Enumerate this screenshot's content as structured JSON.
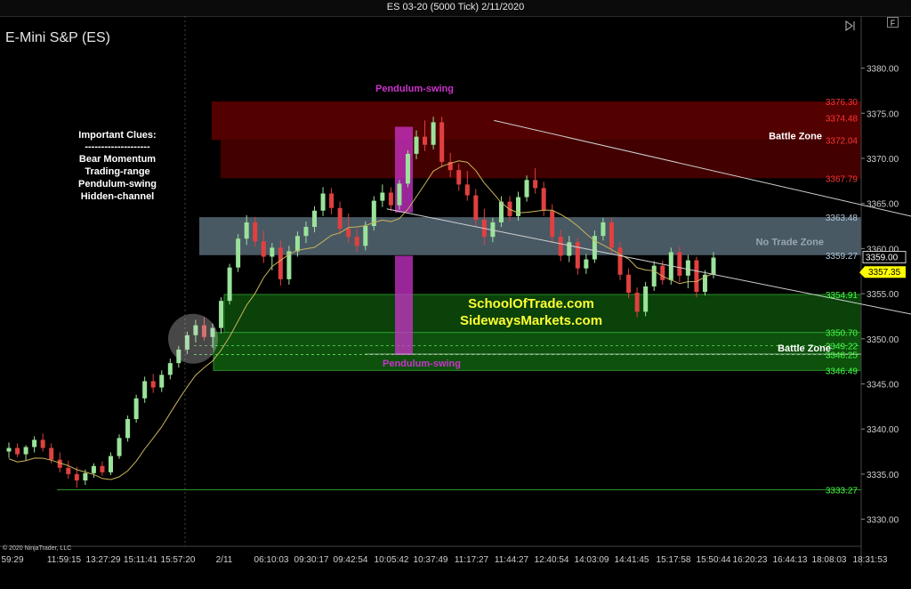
{
  "window": {
    "title": "ES 03-20 (5000 Tick)  2/11/2020"
  },
  "toolbar": {
    "f_label": "F",
    "nav_icon": "skip-end-icon"
  },
  "chart_title": "E-Mini S&P (ES)",
  "copyright": "© 2020 NinjaTrader, LLC",
  "clues": {
    "title": "Important Clues:",
    "separator": "--------------------",
    "items": [
      "Bear Momentum",
      "Trading-range",
      "Pendulum-swing",
      "Hidden-channel"
    ]
  },
  "watermark": [
    "SchoolOfTrade.com",
    "SidewaysMarkets.com"
  ],
  "chart_data": {
    "type": "candlestick",
    "ylim": [
      3327,
      3384
    ],
    "y_ticks": [
      3380,
      3375,
      3370,
      3365,
      3360,
      3355,
      3350,
      3345,
      3340,
      3335,
      3330
    ],
    "y_tick_labels": [
      "3380.00",
      "3375.00",
      "3370.00",
      "3365.00",
      "3360.00",
      "3355.00",
      "3350.00",
      "3345.00",
      "3340.00",
      "3335.00",
      "3330.00"
    ],
    "x_tick_labels": [
      "59:29",
      "11:59:15",
      "13:27:29",
      "15:11:41",
      "15:57:20",
      "2/11",
      "06:10:03",
      "09:30:17",
      "09:42:54",
      "10:05:42",
      "10:37:49",
      "11:17:27",
      "11:44:27",
      "12:40:54",
      "14:03:09",
      "14:41:45",
      "15:17:58",
      "15:50:44",
      "16:20:23",
      "16:44:13",
      "18:08:03",
      "18:31:53"
    ],
    "x_tick_count": 22,
    "last_price": {
      "value": 3359.0,
      "label": "3359.00"
    },
    "current_price": {
      "value": 3357.35,
      "label": "3357.35",
      "color": "#ffff00"
    },
    "zones": [
      {
        "name": "resistance-outer",
        "top": 3376.3,
        "bottom": 3372.04,
        "color": "#5c0000"
      },
      {
        "name": "resistance-inner",
        "top": 3372.04,
        "bottom": 3367.79,
        "color": "#4a0000"
      },
      {
        "name": "no-trade",
        "top": 3363.48,
        "bottom": 3359.27,
        "color": "#5a6f7d"
      },
      {
        "name": "support-inner",
        "top": 3354.91,
        "bottom": 3350.7,
        "color": "#0c4a0c"
      },
      {
        "name": "support-outer",
        "top": 3350.7,
        "bottom": 3346.49,
        "color": "#0f5a0f"
      }
    ],
    "level_labels": [
      {
        "value": 3376.3,
        "label": "3376.30",
        "color": "#ff3333"
      },
      {
        "value": 3374.48,
        "label": "3374.48",
        "color": "#ff3333"
      },
      {
        "value": 3372.04,
        "label": "3372.04",
        "color": "#ff3333"
      },
      {
        "value": 3367.79,
        "label": "3367.79",
        "color": "#ff3333"
      },
      {
        "value": 3363.48,
        "label": "3363.48",
        "color": "#b0c4d4"
      },
      {
        "value": 3359.27,
        "label": "3359.27",
        "color": "#b0c4d4"
      },
      {
        "value": 3354.91,
        "label": "3354.91",
        "color": "#44ff44"
      },
      {
        "value": 3350.7,
        "label": "3350.70",
        "color": "#44ff44"
      },
      {
        "value": 3349.22,
        "label": "3349.22",
        "color": "#44ff44"
      },
      {
        "value": 3348.25,
        "label": "3348.25",
        "color": "#44ff44"
      },
      {
        "value": 3346.49,
        "label": "3346.49",
        "color": "#44ff44"
      },
      {
        "value": 3333.27,
        "label": "3333.27",
        "color": "#44ff44"
      }
    ],
    "zone_labels": [
      {
        "text": "Battle Zone",
        "value": 3372.5,
        "color": "#ffffff"
      },
      {
        "text": "No Trade Zone",
        "value": 3360.8,
        "color": "#9aa6ad"
      },
      {
        "text": "Battle Zone",
        "value": 3349.0,
        "color": "#ffffff"
      }
    ],
    "pendulum_labels": [
      "Pendulum-swing",
      "Pendulum-swing"
    ],
    "pendulum_color": "#cc33cc",
    "trend_lines": [
      {
        "from": [
          95,
          3374.2
        ],
        "to": [
          192,
          3361.6
        ],
        "color": "#cfcfcf"
      },
      {
        "from": [
          74,
          3364.4
        ],
        "to": [
          192,
          3351.0
        ],
        "color": "#cfcfcf"
      }
    ],
    "candles": [
      [
        3337.5,
        3338.5,
        3336.8,
        3337.9
      ],
      [
        3337.9,
        3338.4,
        3336.9,
        3337.2
      ],
      [
        3337.2,
        3338.2,
        3336.5,
        3338.0
      ],
      [
        3338.0,
        3339.2,
        3337.4,
        3338.8
      ],
      [
        3338.8,
        3339.5,
        3337.5,
        3337.9
      ],
      [
        3337.9,
        3338.4,
        3336.2,
        3336.6
      ],
      [
        3336.6,
        3337.4,
        3335.2,
        3335.7
      ],
      [
        3335.7,
        3336.5,
        3334.5,
        3335.0
      ],
      [
        3335.0,
        3335.8,
        3333.5,
        3334.3
      ],
      [
        3334.3,
        3335.5,
        3333.8,
        3335.1
      ],
      [
        3335.1,
        3336.2,
        3334.6,
        3335.9
      ],
      [
        3335.9,
        3336.4,
        3334.8,
        3335.2
      ],
      [
        3335.2,
        3337.4,
        3334.9,
        3337.0
      ],
      [
        3337.0,
        3339.4,
        3336.7,
        3339.0
      ],
      [
        3339.0,
        3341.5,
        3338.6,
        3341.1
      ],
      [
        3341.1,
        3343.8,
        3340.7,
        3343.4
      ],
      [
        3343.4,
        3345.8,
        3342.9,
        3345.3
      ],
      [
        3345.3,
        3346.1,
        3344.0,
        3344.6
      ],
      [
        3344.6,
        3346.5,
        3344.1,
        3346.0
      ],
      [
        3346.0,
        3347.8,
        3345.5,
        3347.3
      ],
      [
        3347.3,
        3349.2,
        3346.8,
        3348.8
      ],
      [
        3348.8,
        3350.8,
        3348.3,
        3350.4
      ],
      [
        3350.4,
        3352.1,
        3349.6,
        3351.5
      ],
      [
        3351.5,
        3352.4,
        3349.8,
        3350.2
      ],
      [
        3350.2,
        3351.7,
        3349.0,
        3351.2
      ],
      [
        3351.2,
        3354.6,
        3350.6,
        3354.2
      ],
      [
        3354.2,
        3358.3,
        3353.8,
        3357.9
      ],
      [
        3357.9,
        3361.6,
        3357.4,
        3361.1
      ],
      [
        3361.1,
        3363.7,
        3360.4,
        3362.9
      ],
      [
        3362.9,
        3363.5,
        3360.2,
        3360.8
      ],
      [
        3360.8,
        3362.0,
        3358.4,
        3359.1
      ],
      [
        3359.1,
        3360.6,
        3357.6,
        3360.1
      ],
      [
        3360.1,
        3360.9,
        3355.9,
        3356.6
      ],
      [
        3356.6,
        3360.3,
        3356.0,
        3359.7
      ],
      [
        3359.7,
        3361.9,
        3359.1,
        3361.4
      ],
      [
        3361.4,
        3363.0,
        3360.6,
        3362.4
      ],
      [
        3362.4,
        3364.7,
        3361.8,
        3364.2
      ],
      [
        3364.2,
        3366.8,
        3363.6,
        3366.1
      ],
      [
        3366.1,
        3366.7,
        3363.8,
        3364.5
      ],
      [
        3364.5,
        3365.2,
        3361.6,
        3362.2
      ],
      [
        3362.2,
        3363.9,
        3360.6,
        3361.3
      ],
      [
        3361.3,
        3362.2,
        3359.6,
        3360.3
      ],
      [
        3360.3,
        3363.0,
        3359.8,
        3362.5
      ],
      [
        3362.5,
        3365.8,
        3362.0,
        3365.3
      ],
      [
        3365.3,
        3367.1,
        3364.6,
        3366.2
      ],
      [
        3366.2,
        3366.8,
        3364.2,
        3364.8
      ],
      [
        3364.8,
        3367.6,
        3364.3,
        3367.2
      ],
      [
        3367.2,
        3370.9,
        3366.8,
        3370.5
      ],
      [
        3370.5,
        3373.1,
        3369.9,
        3372.4
      ],
      [
        3372.4,
        3374.2,
        3370.8,
        3371.5
      ],
      [
        3371.5,
        3374.6,
        3371.0,
        3374.0
      ],
      [
        3374.0,
        3374.6,
        3369.0,
        3369.6
      ],
      [
        3369.6,
        3370.6,
        3367.9,
        3368.7
      ],
      [
        3368.7,
        3369.4,
        3366.4,
        3367.1
      ],
      [
        3367.1,
        3368.6,
        3365.3,
        3365.9
      ],
      [
        3365.9,
        3366.6,
        3362.5,
        3363.2
      ],
      [
        3363.2,
        3364.4,
        3360.4,
        3361.3
      ],
      [
        3361.3,
        3363.4,
        3360.7,
        3362.9
      ],
      [
        3362.9,
        3365.8,
        3362.4,
        3365.2
      ],
      [
        3365.2,
        3365.8,
        3363.0,
        3363.6
      ],
      [
        3363.6,
        3366.3,
        3363.1,
        3365.7
      ],
      [
        3365.7,
        3368.1,
        3365.2,
        3367.6
      ],
      [
        3367.6,
        3368.9,
        3366.1,
        3366.7
      ],
      [
        3366.7,
        3367.4,
        3363.6,
        3364.2
      ],
      [
        3364.2,
        3364.9,
        3360.6,
        3361.3
      ],
      [
        3361.3,
        3362.1,
        3358.6,
        3359.2
      ],
      [
        3359.2,
        3361.4,
        3358.5,
        3360.7
      ],
      [
        3360.7,
        3361.2,
        3357.1,
        3357.8
      ],
      [
        3357.8,
        3359.4,
        3357.2,
        3358.8
      ],
      [
        3358.8,
        3362.0,
        3358.4,
        3361.4
      ],
      [
        3361.4,
        3363.4,
        3360.9,
        3362.9
      ],
      [
        3362.9,
        3363.4,
        3359.5,
        3360.1
      ],
      [
        3360.1,
        3360.7,
        3356.5,
        3357.1
      ],
      [
        3357.1,
        3357.8,
        3354.5,
        3355.1
      ],
      [
        3355.1,
        3355.7,
        3352.4,
        3353.0
      ],
      [
        3353.0,
        3356.3,
        3352.5,
        3355.8
      ],
      [
        3355.8,
        3358.6,
        3355.3,
        3358.1
      ],
      [
        3358.1,
        3358.7,
        3356.0,
        3356.5
      ],
      [
        3356.5,
        3360.1,
        3356.0,
        3359.6
      ],
      [
        3359.6,
        3360.2,
        3356.3,
        3357.0
      ],
      [
        3357.0,
        3359.3,
        3355.6,
        3358.7
      ],
      [
        3358.7,
        3359.1,
        3354.6,
        3355.2
      ],
      [
        3355.2,
        3357.6,
        3354.8,
        3357.1
      ],
      [
        3357.1,
        3359.6,
        3356.7,
        3359.0
      ]
    ],
    "candle_up_color": "#9be39b",
    "candle_down_color": "#e04040",
    "ma_color": "#c8b45a"
  }
}
